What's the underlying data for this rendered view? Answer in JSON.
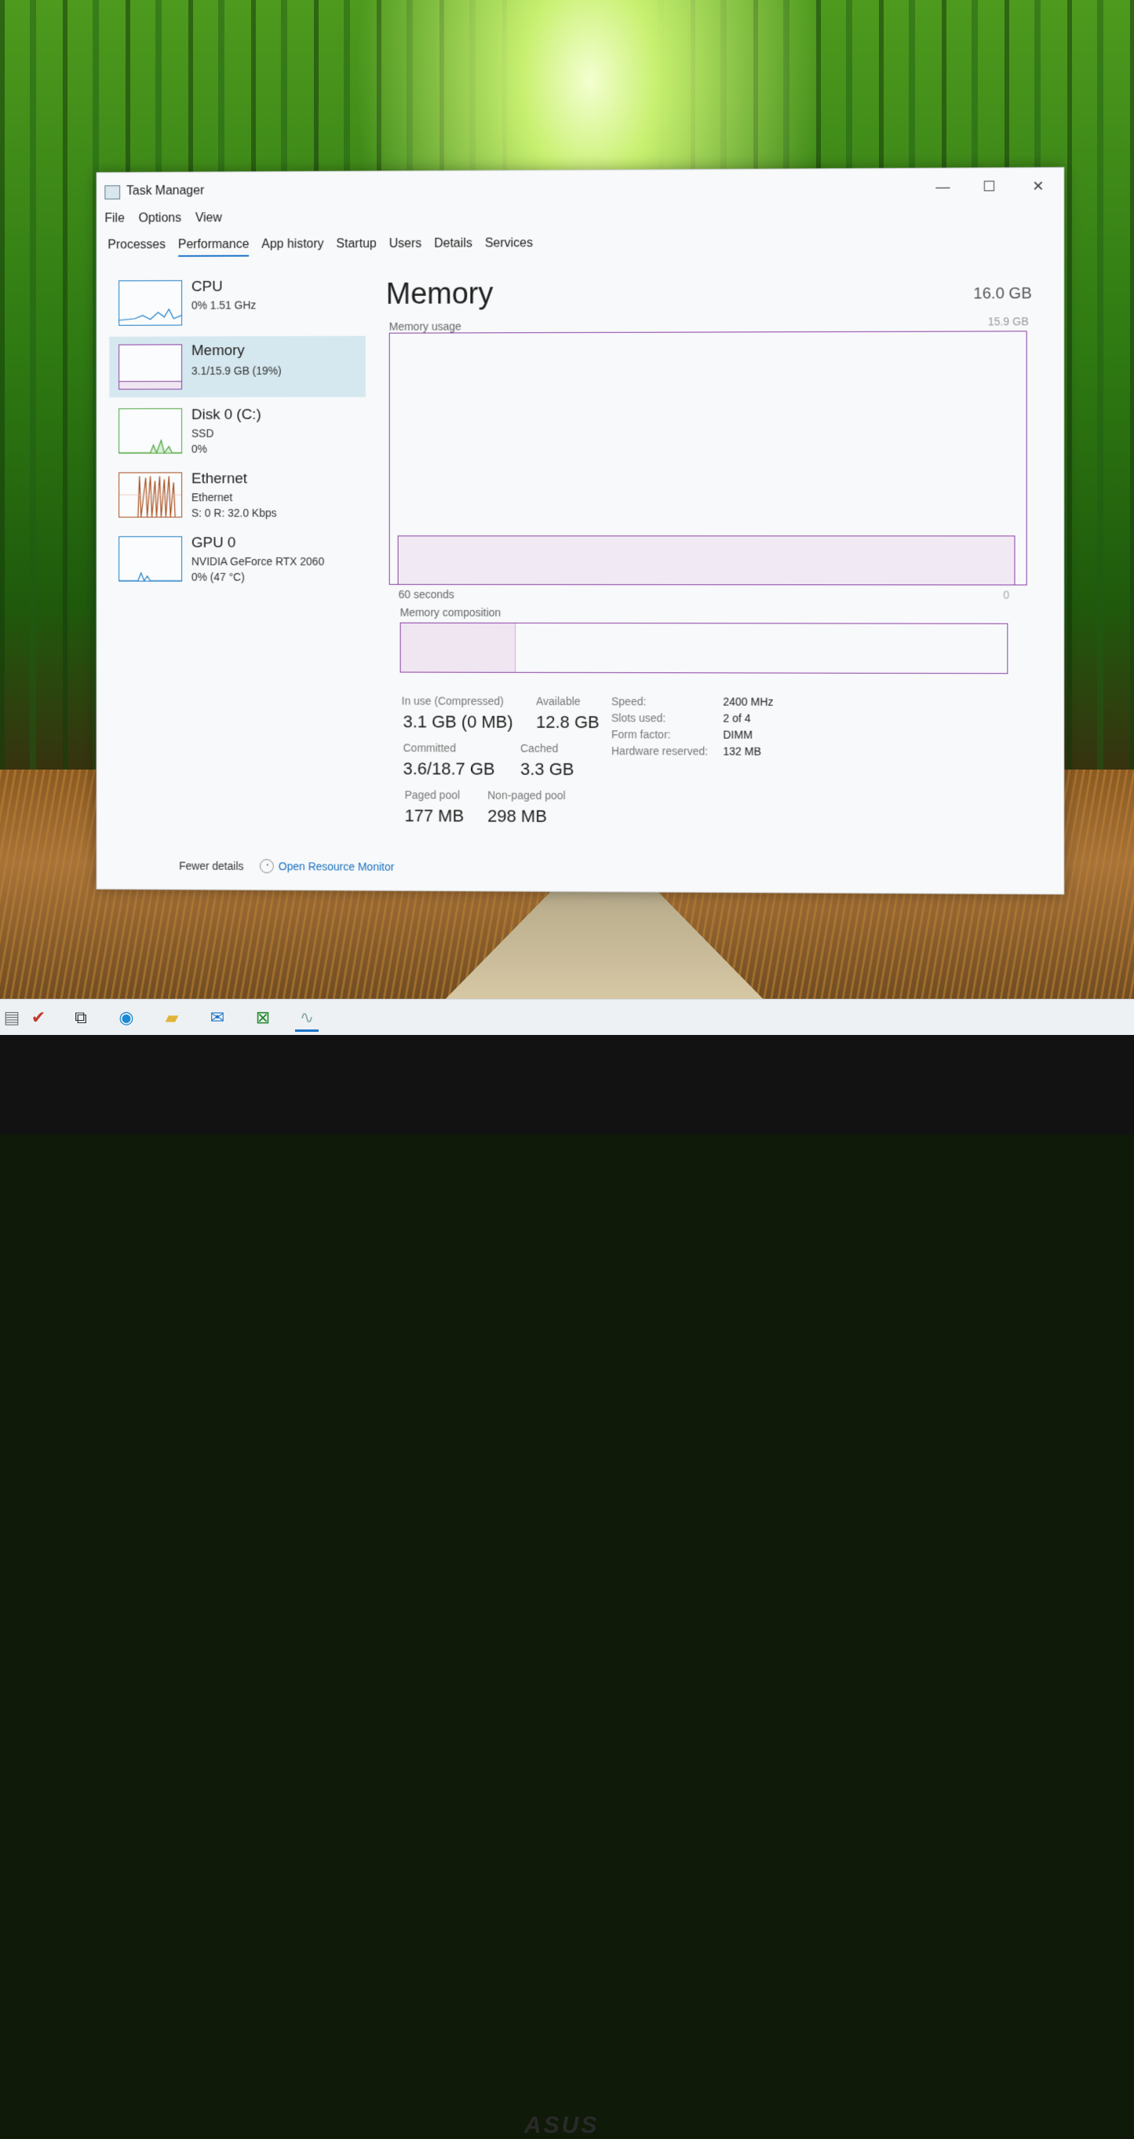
{
  "window": {
    "title": "Task Manager",
    "controls": {
      "minimize": "—",
      "maximize": "☐",
      "close": "✕"
    }
  },
  "menu": [
    "File",
    "Options",
    "View"
  ],
  "tabs": [
    "Processes",
    "Performance",
    "App history",
    "Startup",
    "Users",
    "Details",
    "Services"
  ],
  "active_tab": "Performance",
  "sidebar": {
    "items": [
      {
        "name": "CPU",
        "line1": "0% 1.51 GHz",
        "line2": "",
        "color": "#1a7cc4"
      },
      {
        "name": "Memory",
        "line1": "3.1/15.9 GB (19%)",
        "line2": "",
        "color": "#8b3fa3"
      },
      {
        "name": "Disk 0 (C:)",
        "line1": "SSD",
        "line2": "0%",
        "color": "#4aa33a"
      },
      {
        "name": "Ethernet",
        "line1": "Ethernet",
        "line2": "S: 0 R: 32.0 Kbps",
        "color": "#a84b1a"
      },
      {
        "name": "GPU 0",
        "line1": "NVIDIA GeForce RTX 2060",
        "line2": "0% (47 °C)",
        "color": "#1a7cc4"
      }
    ],
    "selected": "Memory"
  },
  "main": {
    "title": "Memory",
    "total": "16.0 GB",
    "usage_label": "Memory usage",
    "usage_max": "15.9 GB",
    "time_left": "60 seconds",
    "time_right": "0",
    "composition_label": "Memory composition",
    "stats": {
      "in_use_label": "In use (Compressed)",
      "in_use_value": "3.1 GB (0 MB)",
      "available_label": "Available",
      "available_value": "12.8 GB",
      "committed_label": "Committed",
      "committed_value": "3.6/18.7 GB",
      "cached_label": "Cached",
      "cached_value": "3.3 GB",
      "paged_label": "Paged pool",
      "paged_value": "177 MB",
      "nonpaged_label": "Non-paged pool",
      "nonpaged_value": "298 MB"
    },
    "details": [
      {
        "label": "Speed:",
        "value": "2400 MHz"
      },
      {
        "label": "Slots used:",
        "value": "2 of 4"
      },
      {
        "label": "Form factor:",
        "value": "DIMM"
      },
      {
        "label": "Hardware reserved:",
        "value": "132 MB"
      }
    ],
    "usage_fraction": 0.19,
    "composition_in_use_fraction": 0.19
  },
  "footer": {
    "fewer": "Fewer details",
    "monitor_link": "Open Resource Monitor"
  },
  "taskbar": {
    "icons": [
      "notepad-icon",
      "checklist-icon",
      "task-view-icon",
      "edge-icon",
      "file-explorer-icon",
      "mail-icon",
      "xbox-icon",
      "taskmanager-icon"
    ]
  },
  "monitor_brand": "ASUS",
  "accent": "#1a73c8",
  "memory_color": "#8b3fa3"
}
